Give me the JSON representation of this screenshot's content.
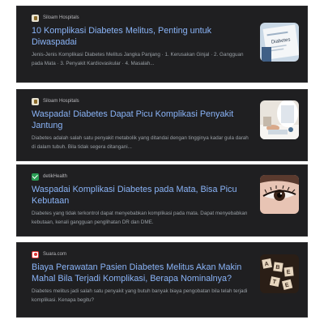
{
  "results": [
    {
      "source": "Siloam Hospitals",
      "title": "10 Komplikasi Diabetes Melitus, Penting untuk Diwaspadai",
      "snippet": "Jenis-Jenis Komplikasi Diabetes Melitus Jangka Panjang · 1. Kerusakan Ginjal · 2. Gangguan pada Mata · 3. Penyakit Kardiovaskular · 4. Masalah...",
      "thumb_icon": "diabetes-paper-thumbnail",
      "thumb_text": "Diabetes"
    },
    {
      "source": "Siloam Hospitals",
      "title": "Waspada! Diabetes Dapat Picu Komplikasi Penyakit Jantung",
      "snippet": "Diabetes adalah salah satu penyakit metabolik yang ditandai dengan tingginya kadar gula darah di dalam tubuh. Bila tidak segera ditangani...",
      "thumb_icon": "doctor-consultation-thumbnail"
    },
    {
      "source": "detikHealth",
      "title": "Waspadai Komplikasi Diabetes pada Mata, Bisa Picu Kebutaan",
      "snippet": "Diabetes yang tidak terkontrol dapat menyebabkan komplikasi pada mata. Dapat menyebabkan kebutaan, kenali gangguan penglihatan DR dan DME.",
      "thumb_icon": "eye-closeup-thumbnail"
    },
    {
      "source": "Suara.com",
      "title": "Biaya Perawatan Pasien Diabetes Melitus Akan Makin Mahal Bila Terjadi Komplikasi, Berapa Nominalnya?",
      "snippet": "Diabetes melitus jadi salah satu penyakit yang butuh banyak biaya pengobatan bila telah terjadi komplikasi. Kenapa begitu?",
      "thumb_icon": "diabetes-letter-blocks-thumbnail",
      "thumb_letters": [
        "A",
        "B",
        "E",
        "T",
        "E"
      ]
    }
  ]
}
